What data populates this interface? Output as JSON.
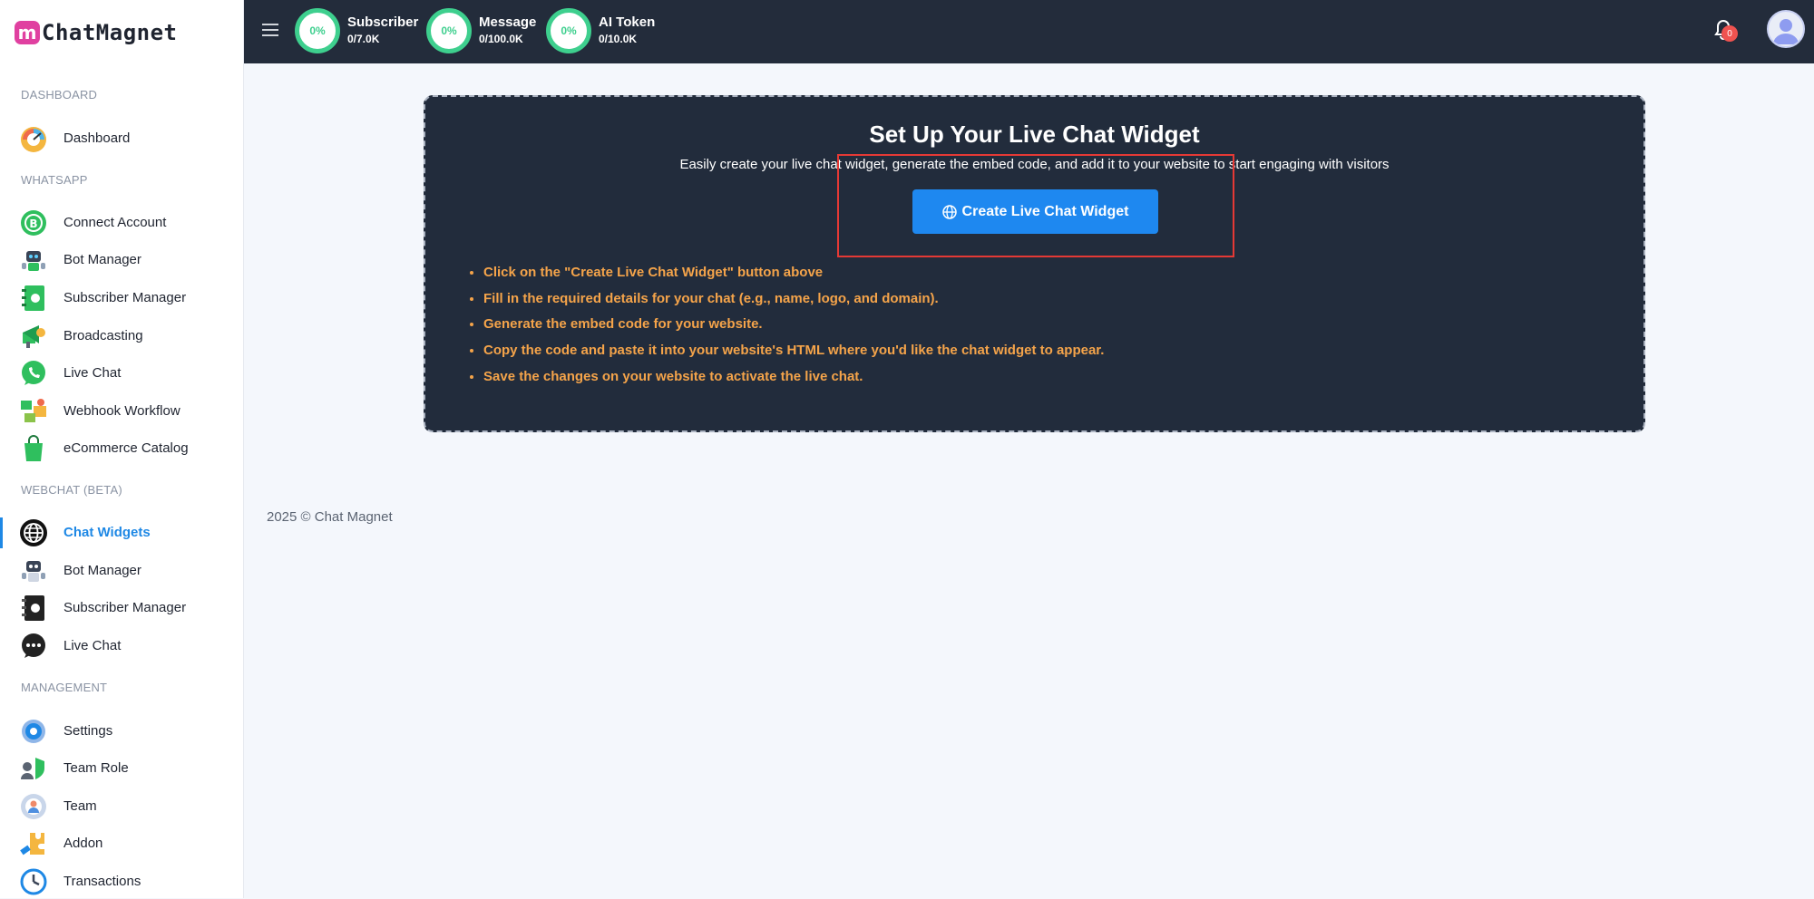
{
  "brand": {
    "logo_letter": "m",
    "name": "ChatMagnet"
  },
  "sidebar": {
    "sections": [
      {
        "label": "DASHBOARD"
      },
      {
        "label": "WHATSAPP"
      },
      {
        "label": "WEBCHAT (BETA)"
      },
      {
        "label": "MANAGEMENT"
      }
    ],
    "items": [
      {
        "label": "Dashboard",
        "icon": "speedometer-icon"
      },
      {
        "label": "Connect Account",
        "icon": "whatsapp-business-icon"
      },
      {
        "label": "Bot Manager",
        "icon": "robot-icon"
      },
      {
        "label": "Subscriber Manager",
        "icon": "contact-book-icon"
      },
      {
        "label": "Broadcasting",
        "icon": "megaphone-icon"
      },
      {
        "label": "Live Chat",
        "icon": "whatsapp-icon"
      },
      {
        "label": "Webhook Workflow",
        "icon": "workflow-icon"
      },
      {
        "label": "eCommerce Catalog",
        "icon": "shopping-bag-icon"
      },
      {
        "label": "Chat Widgets",
        "icon": "globe-icon",
        "active": true
      },
      {
        "label": "Bot Manager",
        "icon": "robot-icon"
      },
      {
        "label": "Subscriber Manager",
        "icon": "contact-book-icon"
      },
      {
        "label": "Live Chat",
        "icon": "chat-bubble-icon"
      },
      {
        "label": "Settings",
        "icon": "gear-icon"
      },
      {
        "label": "Team Role",
        "icon": "shield-user-icon"
      },
      {
        "label": "Team",
        "icon": "team-gear-icon"
      },
      {
        "label": "Addon",
        "icon": "puzzle-icon"
      },
      {
        "label": "Transactions",
        "icon": "clock-icon"
      }
    ]
  },
  "topbar": {
    "stats": [
      {
        "percent": "0%",
        "label": "Subscriber",
        "value": "0/7.0K"
      },
      {
        "percent": "0%",
        "label": "Message",
        "value": "0/100.0K"
      },
      {
        "percent": "0%",
        "label": "AI Token",
        "value": "0/10.0K"
      }
    ],
    "notification_count": "0"
  },
  "main": {
    "title": "Set Up Your Live Chat Widget",
    "subtitle": "Easily create your live chat widget, generate the embed code, and add it to your website to start engaging with visitors",
    "cta_label": "Create Live Chat Widget",
    "steps": [
      "Click on the \"Create Live Chat Widget\" button above",
      "Fill in the required details for your chat (e.g., name, logo, and domain).",
      "Generate the embed code for your website.",
      "Copy the code and paste it into your website's HTML where you'd like the chat widget to appear.",
      "Save the changes on your website to activate the live chat."
    ]
  },
  "footer": {
    "text": "2025 © Chat Magnet"
  },
  "colors": {
    "accent": "#1e88f0",
    "topbar": "#232c3b",
    "card": "#222c3c",
    "step_text": "#f5a44a",
    "ring": "#3ecf8e",
    "badge": "#ef5350"
  }
}
